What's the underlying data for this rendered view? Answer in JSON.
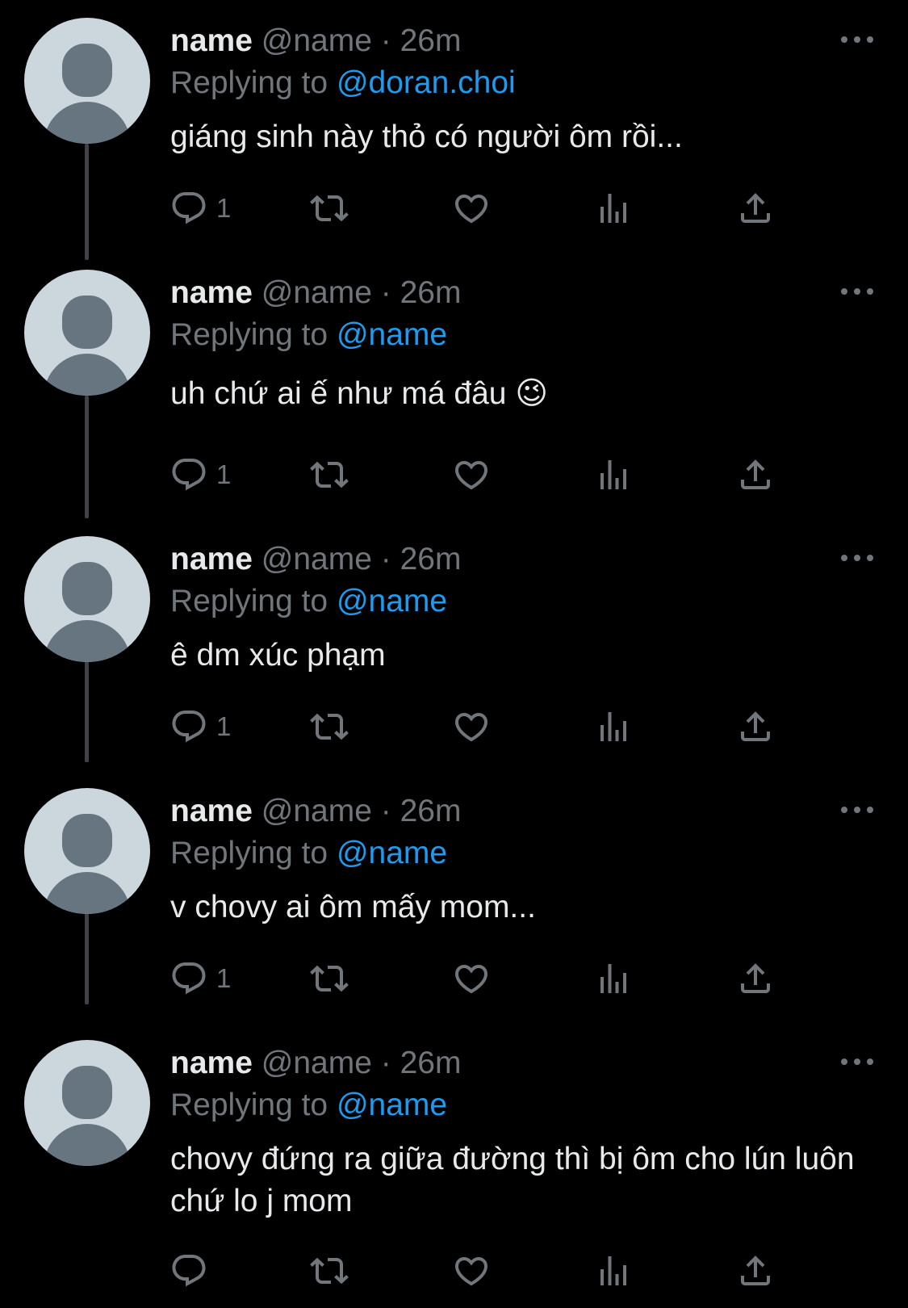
{
  "tweets": [
    {
      "name": "name",
      "handle": "@name",
      "dot": "·",
      "time": "26m",
      "replying_prefix": "Replying to ",
      "replying_to": "@doran.choi",
      "text": "giáng sinh này thỏ có người ôm rồi...",
      "reply_count": "1"
    },
    {
      "name": "name",
      "handle": "@name",
      "dot": "·",
      "time": "26m",
      "replying_prefix": "Replying to ",
      "replying_to": "@name",
      "text": "uh chứ ai ế như má đâu 😉",
      "reply_count": "1"
    },
    {
      "name": "name",
      "handle": "@name",
      "dot": "·",
      "time": "26m",
      "replying_prefix": "Replying to ",
      "replying_to": "@name",
      "text": "ê dm xúc phạm",
      "reply_count": "1"
    },
    {
      "name": "name",
      "handle": "@name",
      "dot": "·",
      "time": "26m",
      "replying_prefix": "Replying to ",
      "replying_to": "@name",
      "text": "v chovy ai ôm mấy mom...",
      "reply_count": "1"
    },
    {
      "name": "name",
      "handle": "@name",
      "dot": "·",
      "time": "26m",
      "replying_prefix": "Replying to ",
      "replying_to": "@name",
      "text": "chovy đứng ra giữa đường thì bị ôm cho lún luôn chứ lo j mom",
      "reply_count": ""
    }
  ],
  "icons": {
    "reply": "reply-icon",
    "retweet": "retweet-icon",
    "like": "like-icon",
    "views": "views-icon",
    "share": "share-icon",
    "more": "more-icon"
  },
  "colors": {
    "background": "#000000",
    "text": "#e7e9ea",
    "secondary": "#71767b",
    "link": "#1d9bf0",
    "thread_line": "#3f4347",
    "avatar_bg": "#ccd6dd",
    "avatar_fg": "#66757f"
  }
}
